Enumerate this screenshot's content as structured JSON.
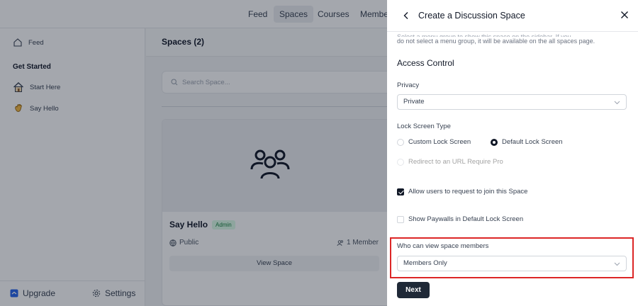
{
  "topnav": {
    "items": [
      {
        "label": "Feed",
        "active": false
      },
      {
        "label": "Spaces",
        "active": true
      },
      {
        "label": "Courses",
        "active": false
      },
      {
        "label": "Members",
        "active": false
      }
    ]
  },
  "sidebar": {
    "feed_label": "Feed",
    "section_heading": "Get Started",
    "items": [
      {
        "label": "Start Here",
        "icon": "house-emoji-icon"
      },
      {
        "label": "Say Hello",
        "icon": "waving-hand-emoji-icon"
      }
    ],
    "footer": {
      "upgrade_label": "Upgrade",
      "settings_label": "Settings"
    }
  },
  "main": {
    "title": "Spaces (2)",
    "search_placeholder": "Search Space...",
    "card": {
      "title": "Say Hello",
      "badge": "Admin",
      "privacy": "Public",
      "members": "1 Member",
      "button_label": "View Space"
    }
  },
  "drawer": {
    "title": "Create a Discussion Space",
    "help_text_cut": "Select a menu group to show this space on the sidebar. If you",
    "help_text": "do not select a menu group, it will be available on the all spaces page.",
    "section_title": "Access Control",
    "privacy_label": "Privacy",
    "privacy_value": "Private",
    "lock_label": "Lock Screen Type",
    "lock_options": [
      {
        "label": "Custom Lock Screen",
        "checked": false
      },
      {
        "label": "Default Lock Screen",
        "checked": true
      }
    ],
    "redirect_label": "Redirect to an URL Require Pro",
    "allow_request_label": "Allow users to request to join this Space",
    "allow_request_checked": true,
    "paywall_label": "Show Paywalls in Default Lock Screen",
    "paywall_checked": false,
    "view_members_label": "Who can view space members",
    "view_members_value": "Members Only",
    "next_label": "Next"
  },
  "colors": {
    "accent": "#1f2937",
    "highlight": "#dc2626",
    "badge_green": "#15803d"
  }
}
